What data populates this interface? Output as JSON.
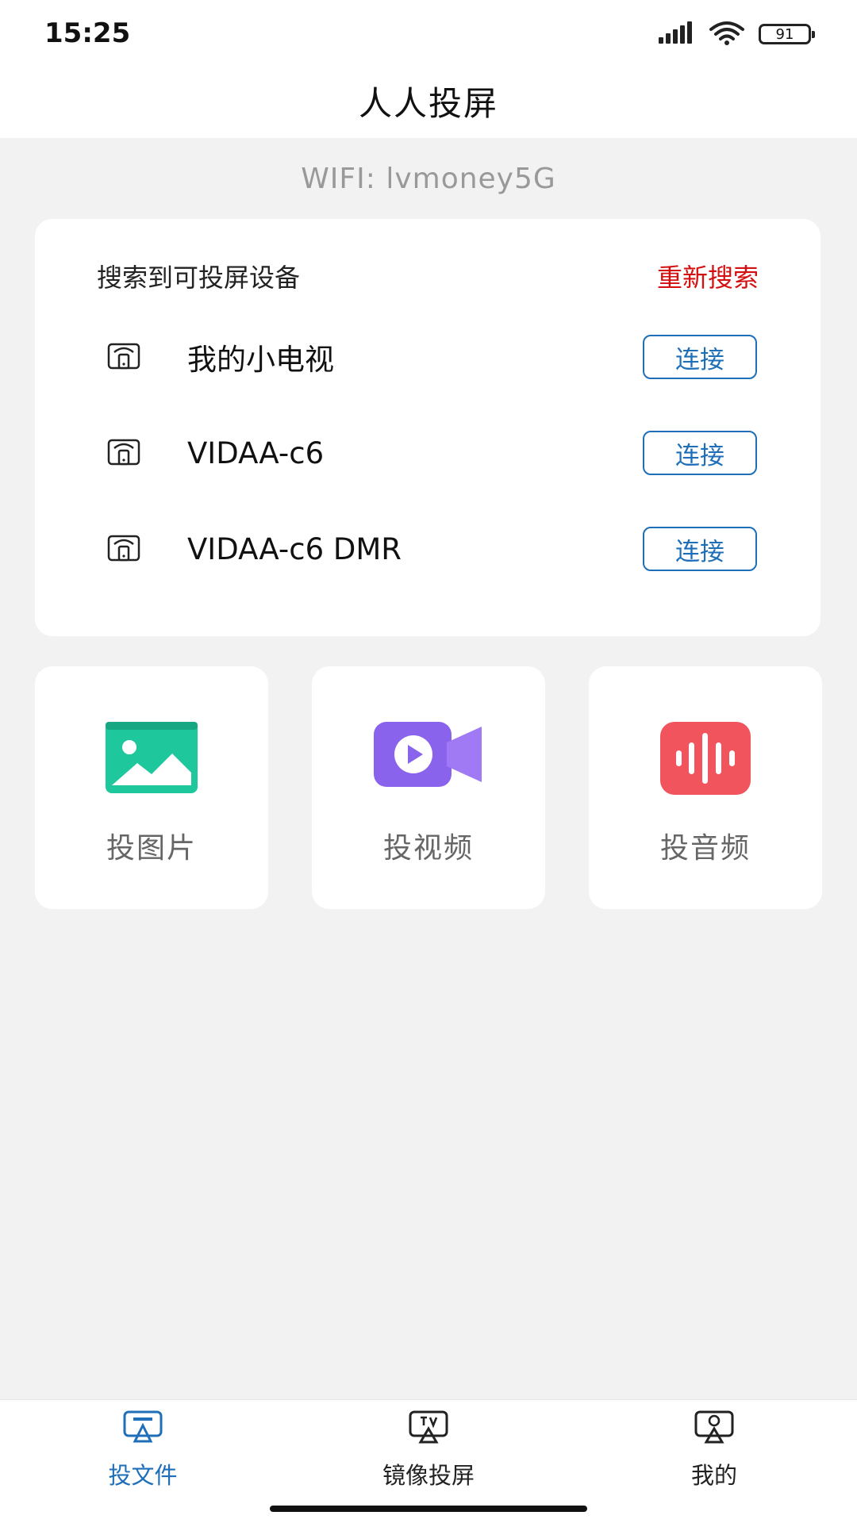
{
  "status_bar": {
    "time": "15:25",
    "battery": "91",
    "icons": [
      "signal-icon",
      "wifi-icon",
      "battery-icon"
    ]
  },
  "header": {
    "title": "人人投屏"
  },
  "wifi": {
    "label": "WIFI: lvmoney5G"
  },
  "device_card": {
    "title": "搜索到可投屏设备",
    "rescan_label": "重新搜索",
    "devices": [
      {
        "name": "我的小电视",
        "action": "连接",
        "icon": "cast-device-icon"
      },
      {
        "name": "VIDAA-c6",
        "action": "连接",
        "icon": "cast-device-icon"
      },
      {
        "name": "VIDAA-c6 DMR",
        "action": "连接",
        "icon": "cast-device-icon"
      }
    ]
  },
  "tiles": [
    {
      "label": "投图片",
      "icon": "image-icon",
      "color": "#1fc79c"
    },
    {
      "label": "投视频",
      "icon": "video-icon",
      "color": "#8a63ec"
    },
    {
      "label": "投音频",
      "icon": "audio-icon",
      "color": "#f2545e"
    }
  ],
  "bottom_nav": {
    "items": [
      {
        "label": "投文件",
        "icon": "cast-file-icon",
        "active": true
      },
      {
        "label": "镜像投屏",
        "icon": "tv-mirror-icon",
        "active": false
      },
      {
        "label": "我的",
        "icon": "profile-icon",
        "active": false
      }
    ]
  },
  "colors": {
    "accent": "#1f6fb8",
    "rescan": "#d40f0f",
    "background": "#f2f2f3"
  }
}
